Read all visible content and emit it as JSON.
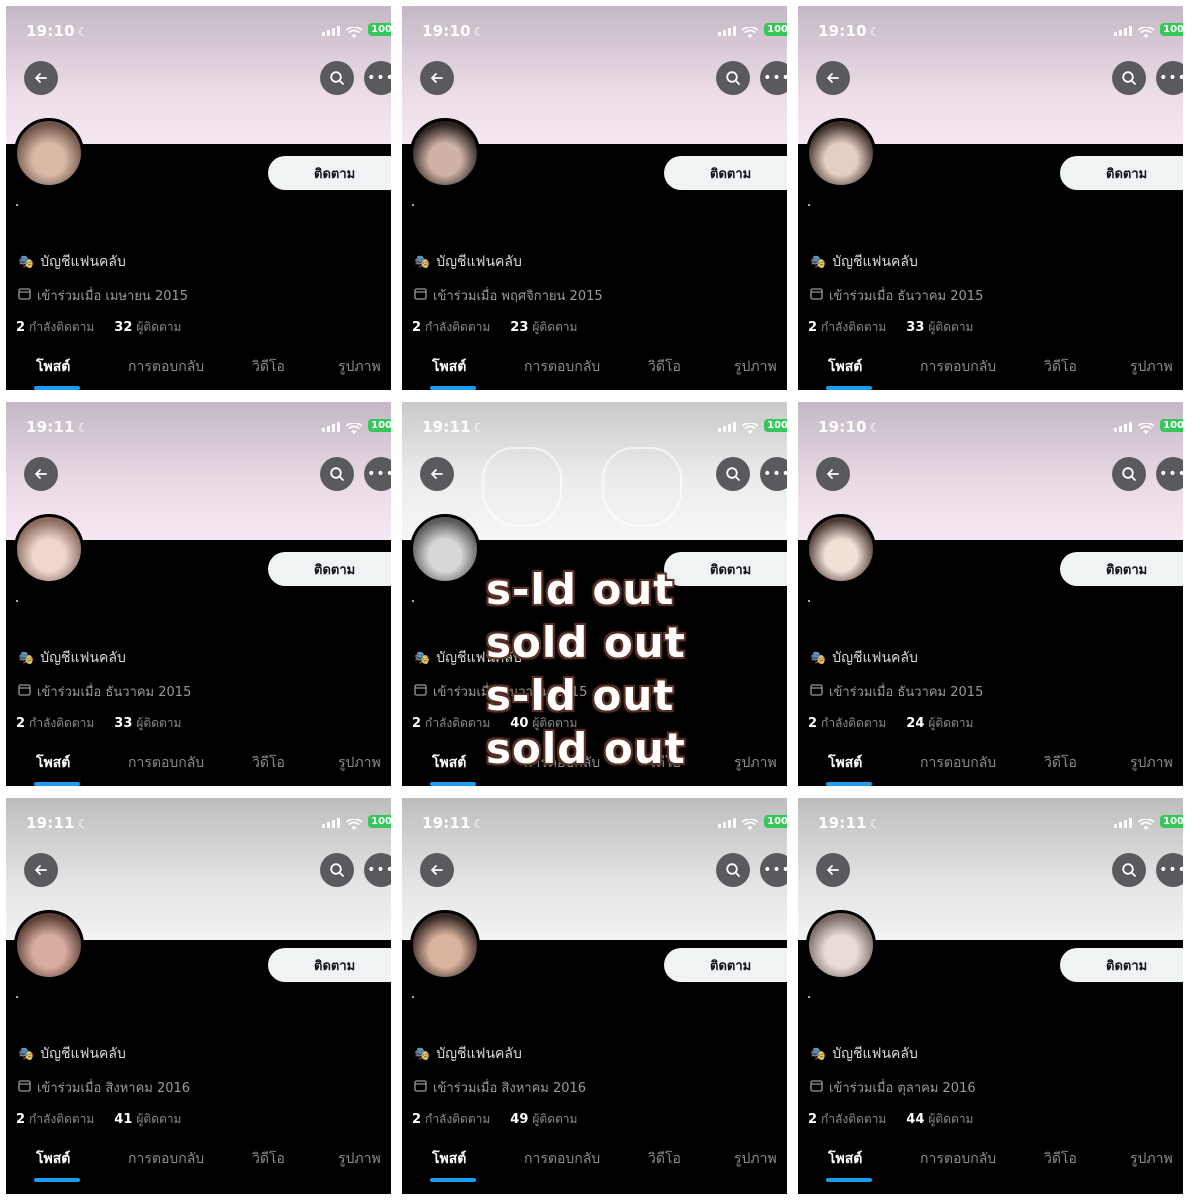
{
  "common": {
    "follow_label": "ติดตาม",
    "fan_label": "บัญชีแฟนคลับ",
    "following_label": "กำลังติดตาม",
    "followers_label": "ผู้ติดตาม",
    "tabs": [
      "โพสต์",
      "การตอบกลับ",
      "วิดีโอ",
      "รูปภาพ"
    ],
    "battery": "100",
    "colors": {
      "tab_indicator": "#1d9bf0",
      "battery": "#35c759",
      "follow_button_bg": "#eff3f4"
    }
  },
  "panels": [
    {
      "time": "19:10",
      "joined": "เข้าร่วมเมื่อ เมษายน 2015",
      "following": "2",
      "followers": "32",
      "banner": "pink"
    },
    {
      "time": "19:10",
      "joined": "เข้าร่วมเมื่อ พฤศจิกายน 2015",
      "following": "2",
      "followers": "23",
      "banner": "pink"
    },
    {
      "time": "19:10",
      "joined": "เข้าร่วมเมื่อ ธันวาคม 2015",
      "following": "2",
      "followers": "33",
      "banner": "pink"
    },
    {
      "time": "19:11",
      "joined": "เข้าร่วมเมื่อ ธันวาคม 2015",
      "following": "2",
      "followers": "33",
      "banner": "pink"
    },
    {
      "time": "19:11",
      "joined": "เข้าร่วมเมื่อ ธันวาคม 2015",
      "following": "2",
      "followers": "40",
      "banner": "art"
    },
    {
      "time": "19:10",
      "joined": "เข้าร่วมเมื่อ ธันวาคม 2015",
      "following": "2",
      "followers": "24",
      "banner": "pink"
    },
    {
      "time": "19:11",
      "joined": "เข้าร่วมเมื่อ สิงหาคม 2016",
      "following": "2",
      "followers": "41",
      "banner": "gray"
    },
    {
      "time": "19:11",
      "joined": "เข้าร่วมเมื่อ สิงหาคม 2016",
      "following": "2",
      "followers": "49",
      "banner": "gray"
    },
    {
      "time": "19:11",
      "joined": "เข้าร่วมเมื่อ ตุลาคม 2016",
      "following": "2",
      "followers": "44",
      "banner": "gray"
    }
  ],
  "overlay": {
    "lines": [
      "s-ld out",
      "sold out",
      "s-ld out",
      "sold out"
    ],
    "text_color": "#ffffff",
    "outline_color": "#5a2f24"
  }
}
